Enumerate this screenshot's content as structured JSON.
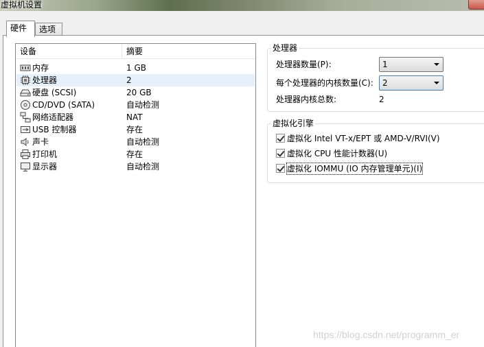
{
  "window": {
    "title": "虚拟机设置"
  },
  "tabs": [
    {
      "label": "硬件",
      "active": true
    },
    {
      "label": "选项",
      "active": false
    }
  ],
  "device_list": {
    "columns": [
      "设备",
      "摘要"
    ],
    "rows": [
      {
        "icon": "memory-icon",
        "name": "内存",
        "summary": "1 GB"
      },
      {
        "icon": "cpu-icon",
        "name": "处理器",
        "summary": "2"
      },
      {
        "icon": "harddisk-icon",
        "name": "硬盘 (SCSI)",
        "summary": "20 GB"
      },
      {
        "icon": "cd-icon",
        "name": "CD/DVD (SATA)",
        "summary": "自动检测"
      },
      {
        "icon": "network-icon",
        "name": "网络适配器",
        "summary": "NAT"
      },
      {
        "icon": "usb-icon",
        "name": "USB 控制器",
        "summary": "存在"
      },
      {
        "icon": "sound-icon",
        "name": "声卡",
        "summary": "自动检测"
      },
      {
        "icon": "printer-icon",
        "name": "打印机",
        "summary": "存在"
      },
      {
        "icon": "display-icon",
        "name": "显示器",
        "summary": "自动检测"
      }
    ],
    "selected_index": 1
  },
  "processor": {
    "legend": "处理器",
    "count_label": "处理器数量(P):",
    "count_value": "1",
    "cores_label": "每个处理器的内核数量(C):",
    "cores_value": "2",
    "total_label": "处理器内核总数:",
    "total_value": "2"
  },
  "virtualization": {
    "legend": "虚拟化引擎",
    "options": [
      {
        "label": "虚拟化 Intel VT-x/EPT 或 AMD-V/RVI(V)",
        "checked": true
      },
      {
        "label": "虚拟化 CPU 性能计数器(U)",
        "checked": true
      },
      {
        "label": "虚拟化 IOMMU (IO 内存管理单元)(I)",
        "checked": true
      }
    ]
  },
  "watermark": "https://blog.csdn.net/programm_er",
  "colors": {
    "selection": "#e6f0fa",
    "border": "#828790",
    "group_border": "#d5dfe5"
  }
}
